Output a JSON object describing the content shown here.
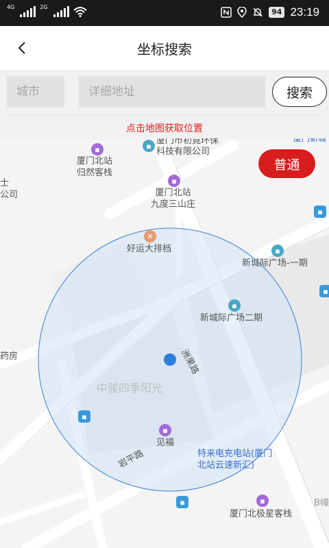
{
  "status_bar": {
    "sim1_label": "4G",
    "sim2_label": "2G",
    "battery": "94",
    "time": "23:19"
  },
  "header": {
    "title": "坐标搜索"
  },
  "search": {
    "city_placeholder": "城市",
    "address_placeholder": "详细地址",
    "search_button": "搜索",
    "hint": "点击地图获取位置"
  },
  "map": {
    "mode_button": "普通",
    "labels": {
      "company_top": "厦门市初竟环保",
      "company_bottom": "科技有限公司",
      "hotel1": "厦门北站\n归然客栈",
      "hotel2": "厦门北站\n九度三山庄",
      "left_edge_1": "士",
      "left_edge_2": "公司",
      "restaurant": "好运大排档",
      "plaza1": "新城际广场-一期",
      "plaza2": "新城际广场二期",
      "road1": "洲果路",
      "left_shop": "药房",
      "area": "中骏四季阳光",
      "shop": "见福",
      "road2": "岩平路",
      "charging": "特来电充电站(厦门\n北站云速新汇)",
      "inn": "厦门北极星客栈",
      "right_cut": "B幢",
      "top_right": "厦门新城"
    },
    "icons": {
      "company": "building-icon",
      "hotel": "bed-icon",
      "restaurant": "fork-knife-icon",
      "plaza": "building-icon",
      "shop": "shopping-bag-icon",
      "bus": "bus-stop-icon"
    },
    "accent_color": "#d91c1c"
  }
}
